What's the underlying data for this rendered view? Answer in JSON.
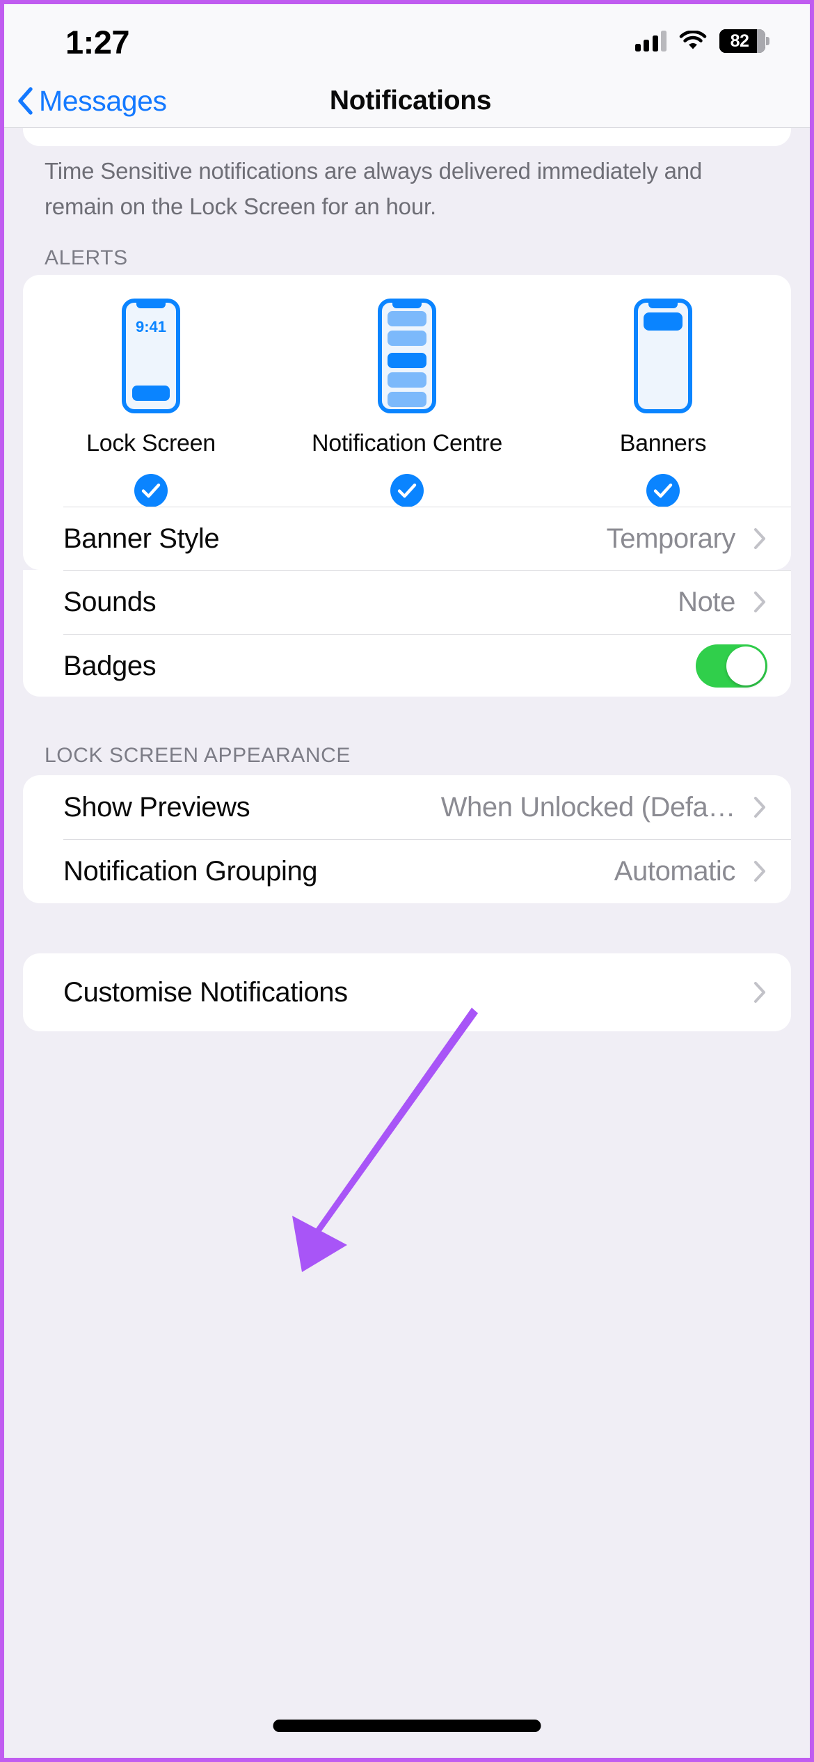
{
  "status_bar": {
    "time": "1:27",
    "battery_percent": "82",
    "cellular_icon": "cellular-bars-icon",
    "wifi_icon": "wifi-icon",
    "battery_icon": "battery-icon"
  },
  "nav_bar": {
    "back_label": "Messages",
    "back_icon": "chevron-left-icon",
    "title": "Notifications"
  },
  "time_sensitive": {
    "toggle_on": true,
    "footnote": "Time Sensitive notifications are always delivered immediately and remain on the Lock Screen for an hour."
  },
  "alerts": {
    "header": "ALERTS",
    "previews": [
      {
        "label": "Lock Screen",
        "checked": true,
        "check_icon": "checkmark-circle-icon",
        "phone_time": "9:41",
        "style": "lock-screen"
      },
      {
        "label": "Notification Centre",
        "checked": true,
        "check_icon": "checkmark-circle-icon",
        "style": "notification-centre"
      },
      {
        "label": "Banners",
        "checked": true,
        "check_icon": "checkmark-circle-icon",
        "style": "banners"
      }
    ],
    "rows": [
      {
        "label": "Banner Style",
        "value": "Temporary",
        "chevron_icon": "chevron-right-icon"
      },
      {
        "label": "Sounds",
        "value": "Note",
        "chevron_icon": "chevron-right-icon"
      },
      {
        "label": "Badges",
        "toggle_on": true
      }
    ]
  },
  "lock_screen_appearance": {
    "header": "LOCK SCREEN APPEARANCE",
    "rows": [
      {
        "label": "Show Previews",
        "value": "When Unlocked (Defa…",
        "chevron_icon": "chevron-right-icon"
      },
      {
        "label": "Notification Grouping",
        "value": "Automatic",
        "chevron_icon": "chevron-right-icon"
      }
    ]
  },
  "customise": {
    "rows": [
      {
        "label": "Customise Notifications",
        "chevron_icon": "chevron-right-icon"
      }
    ]
  },
  "annotation": {
    "arrow_icon": "annotation-arrow-icon",
    "color": "#a855f7",
    "points_at": "Show Previews"
  },
  "colors": {
    "accent_blue": "#1479ff",
    "toggle_green": "#30cf4b",
    "preview_blue": "#0a84ff",
    "page_background": "#f0eef5",
    "card_background": "#ffffff",
    "border_purple": "#c05cf0"
  }
}
